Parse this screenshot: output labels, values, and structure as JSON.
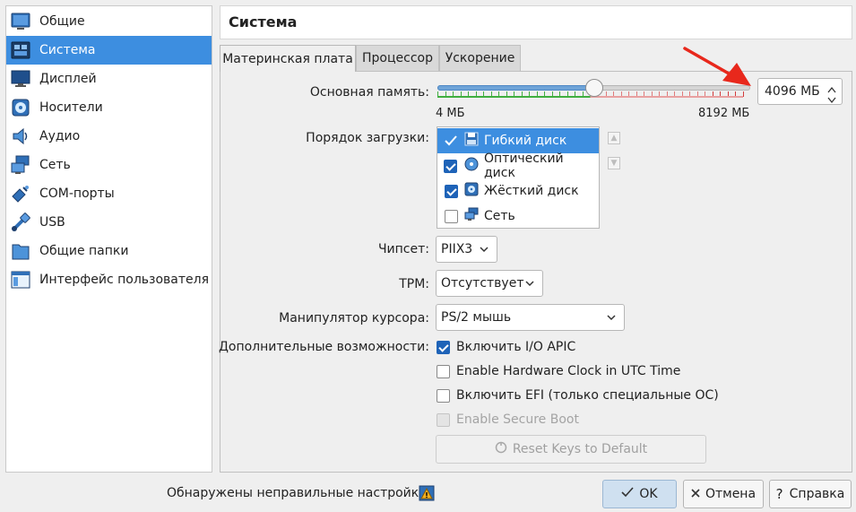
{
  "sidebar": {
    "items": [
      {
        "label": "Общие",
        "icon": "general-icon"
      },
      {
        "label": "Система",
        "icon": "system-icon"
      },
      {
        "label": "Дисплей",
        "icon": "display-icon"
      },
      {
        "label": "Носители",
        "icon": "storage-icon"
      },
      {
        "label": "Аудио",
        "icon": "audio-icon"
      },
      {
        "label": "Сеть",
        "icon": "network-icon"
      },
      {
        "label": "COM-порты",
        "icon": "serial-ports-icon"
      },
      {
        "label": "USB",
        "icon": "usb-icon"
      },
      {
        "label": "Общие папки",
        "icon": "shared-folders-icon"
      },
      {
        "label": "Интерфейс пользователя",
        "icon": "user-interface-icon"
      }
    ],
    "selected": "Система"
  },
  "header": {
    "title": "Система"
  },
  "tabs": [
    {
      "label": "Материнская плата",
      "active": true
    },
    {
      "label": "Процессор",
      "active": false
    },
    {
      "label": "Ускорение",
      "active": false
    }
  ],
  "memory": {
    "label": "Основная память:",
    "value": "4096 МБ",
    "min_label": "4 МБ",
    "max_label": "8192 МБ",
    "slider_fraction": 0.5
  },
  "boot": {
    "label": "Порядок загрузки:",
    "items": [
      {
        "label": "Гибкий диск",
        "checked": true,
        "icon": "floppy-icon"
      },
      {
        "label": "Оптический диск",
        "checked": true,
        "icon": "optical-disc-icon"
      },
      {
        "label": "Жёсткий диск",
        "checked": true,
        "icon": "hard-disk-icon"
      },
      {
        "label": "Сеть",
        "checked": false,
        "icon": "network-icon"
      }
    ]
  },
  "chipset": {
    "label": "Чипсет:",
    "value": "PIIX3"
  },
  "tpm": {
    "label": "TPM:",
    "value": "Отсутствует"
  },
  "pointing": {
    "label": "Манипулятор курсора:",
    "value": "PS/2 мышь"
  },
  "features": {
    "label": "Дополнительные возможности:",
    "io_apic": {
      "label": "Включить I/O APIC",
      "checked": true
    },
    "utc_clock": {
      "label": "Enable Hardware Clock in UTC Time",
      "checked": false
    },
    "efi": {
      "label": "Включить EFI (только специальные ОС)",
      "checked": false
    },
    "secure_boot": {
      "label": "Enable Secure Boot",
      "checked": false,
      "disabled": true
    }
  },
  "reset_keys": {
    "label": "Reset Keys to Default"
  },
  "footer": {
    "warning": "Обнаружены неправильные настройки",
    "ok": "OK",
    "cancel": "Отмена",
    "help": "Справка"
  },
  "colors": {
    "accent": "#3d8ee0",
    "annotation_arrow": "#e8281c"
  }
}
